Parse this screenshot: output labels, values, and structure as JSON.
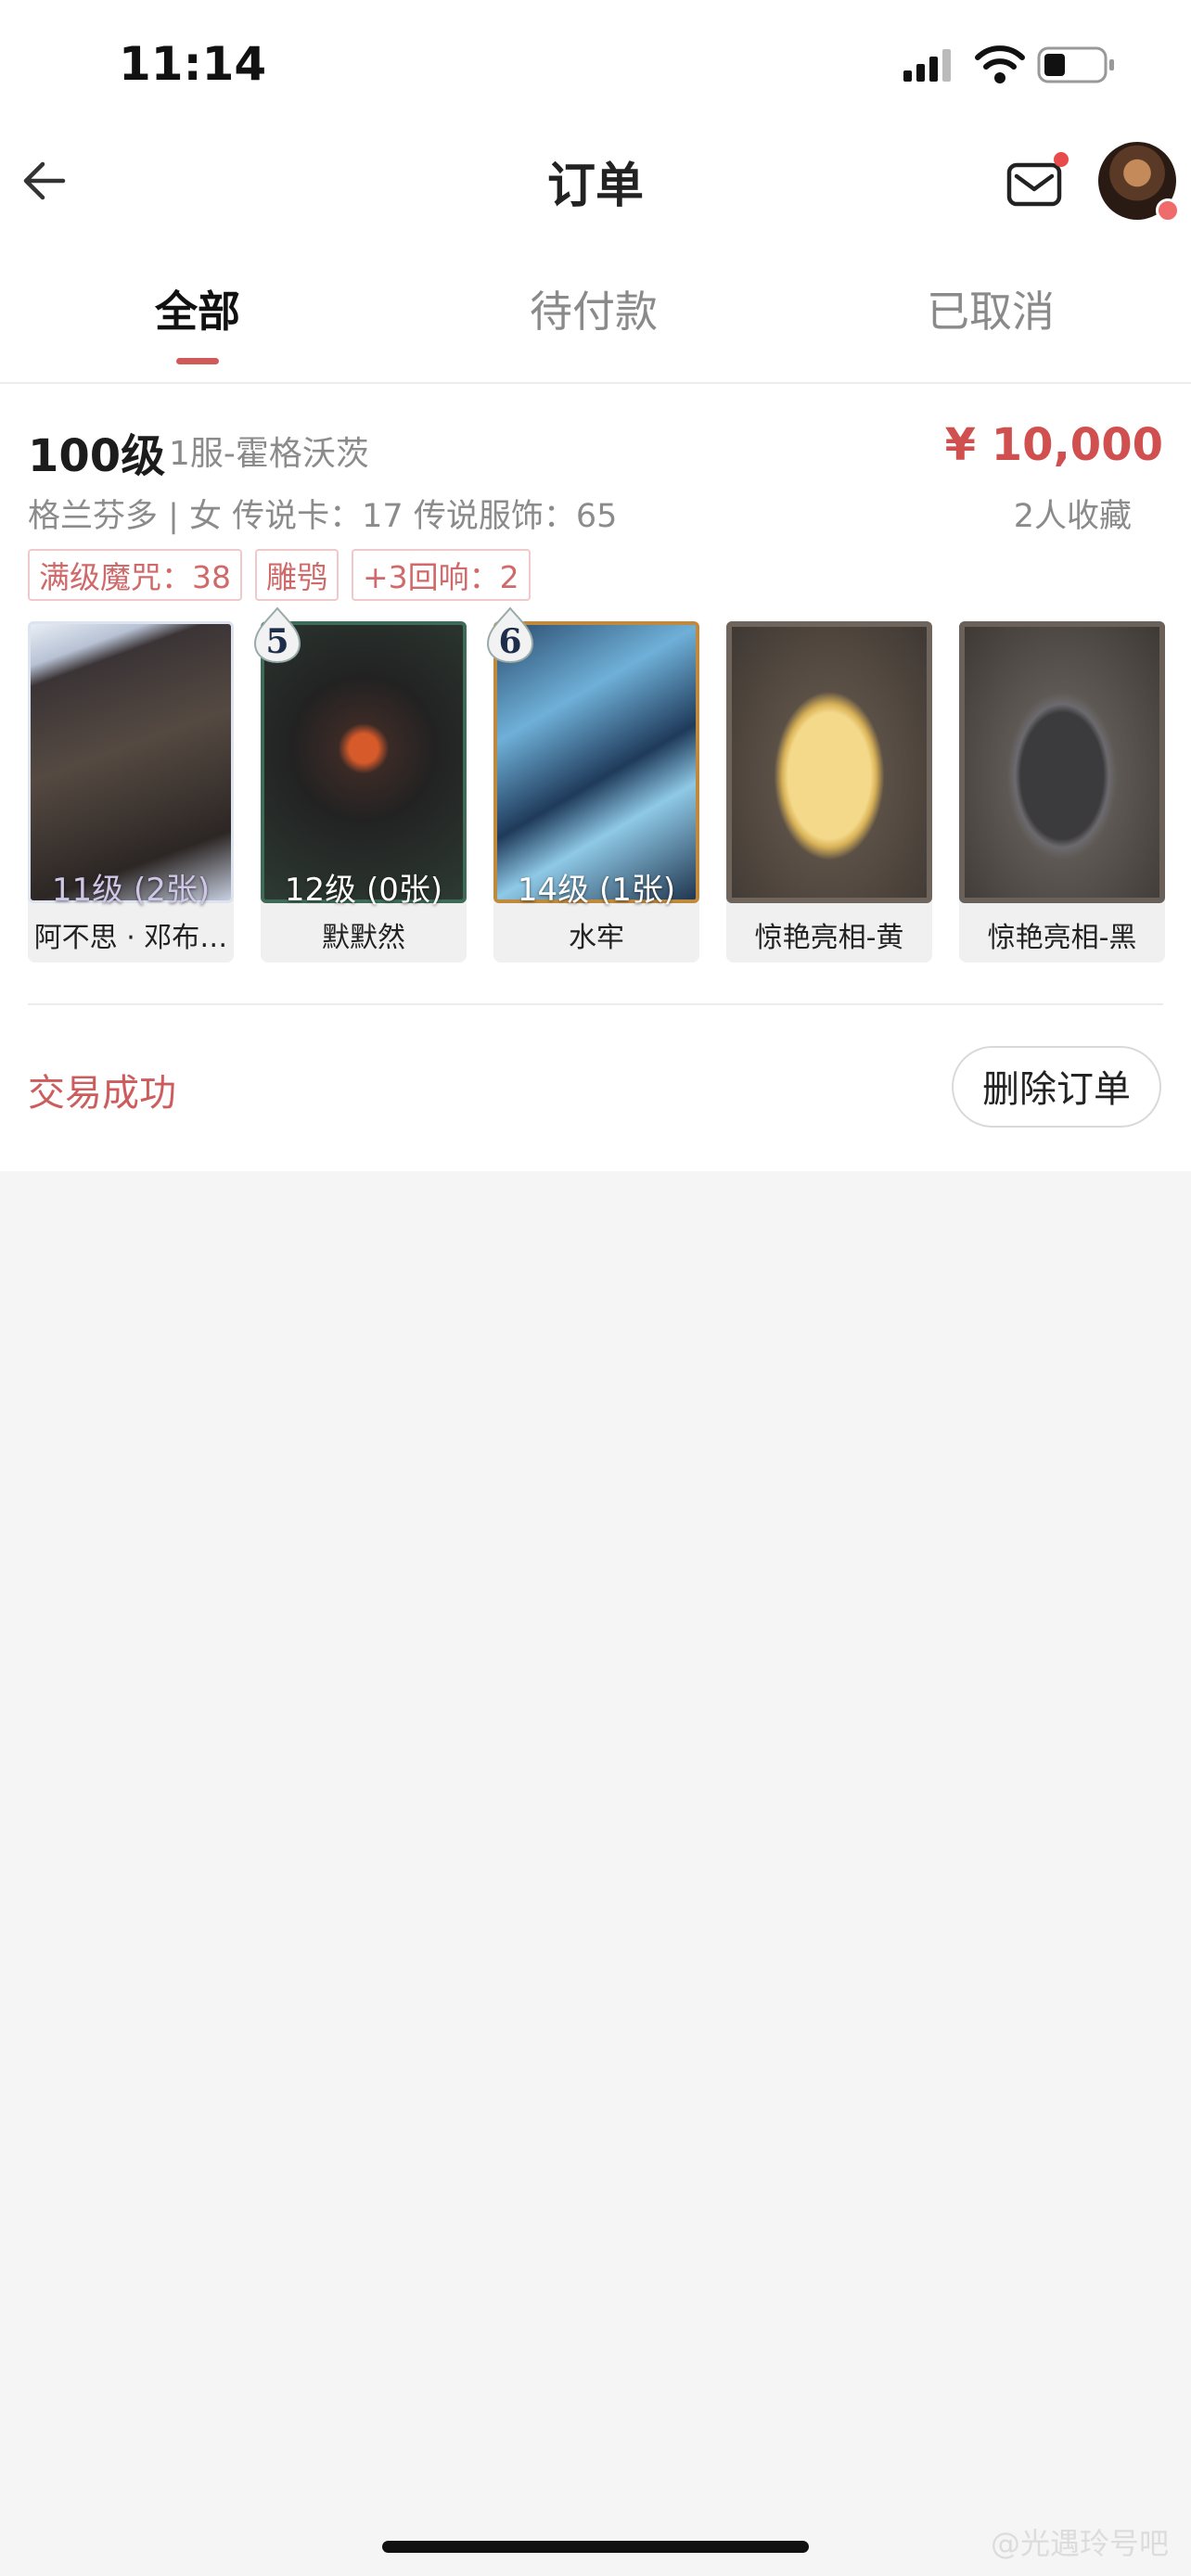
{
  "status_bar": {
    "time": "11:14"
  },
  "nav": {
    "title": "订单"
  },
  "tabs": [
    {
      "label": "全部",
      "active": true
    },
    {
      "label": "待付款",
      "active": false
    },
    {
      "label": "已取消",
      "active": false
    }
  ],
  "order": {
    "level": "100级",
    "server": "1服-霍格沃茨",
    "price": "¥ 10,000",
    "desc": "格兰芬多 | 女  传说卡：17  传说服饰：65",
    "favorites": "2人收藏",
    "tags": [
      "满级魔咒：38",
      "雕鸮",
      "+3回响：2"
    ],
    "items": [
      {
        "name": "阿不思 · 邓布…",
        "level": "11级 (2张)",
        "badge": ""
      },
      {
        "name": "默默然",
        "level": "12级 (0张)",
        "badge": "5"
      },
      {
        "name": "水牢",
        "level": "14级 (1张)",
        "badge": "6"
      },
      {
        "name": "惊艳亮相-黄",
        "level": "",
        "badge": ""
      },
      {
        "name": "惊艳亮相-黑",
        "level": "",
        "badge": ""
      }
    ],
    "status": "交易成功",
    "delete_label": "删除订单"
  },
  "watermark": "@光遇玲号吧",
  "colors": {
    "accent": "#d0504f",
    "tab_underline": "#d05a5a"
  }
}
